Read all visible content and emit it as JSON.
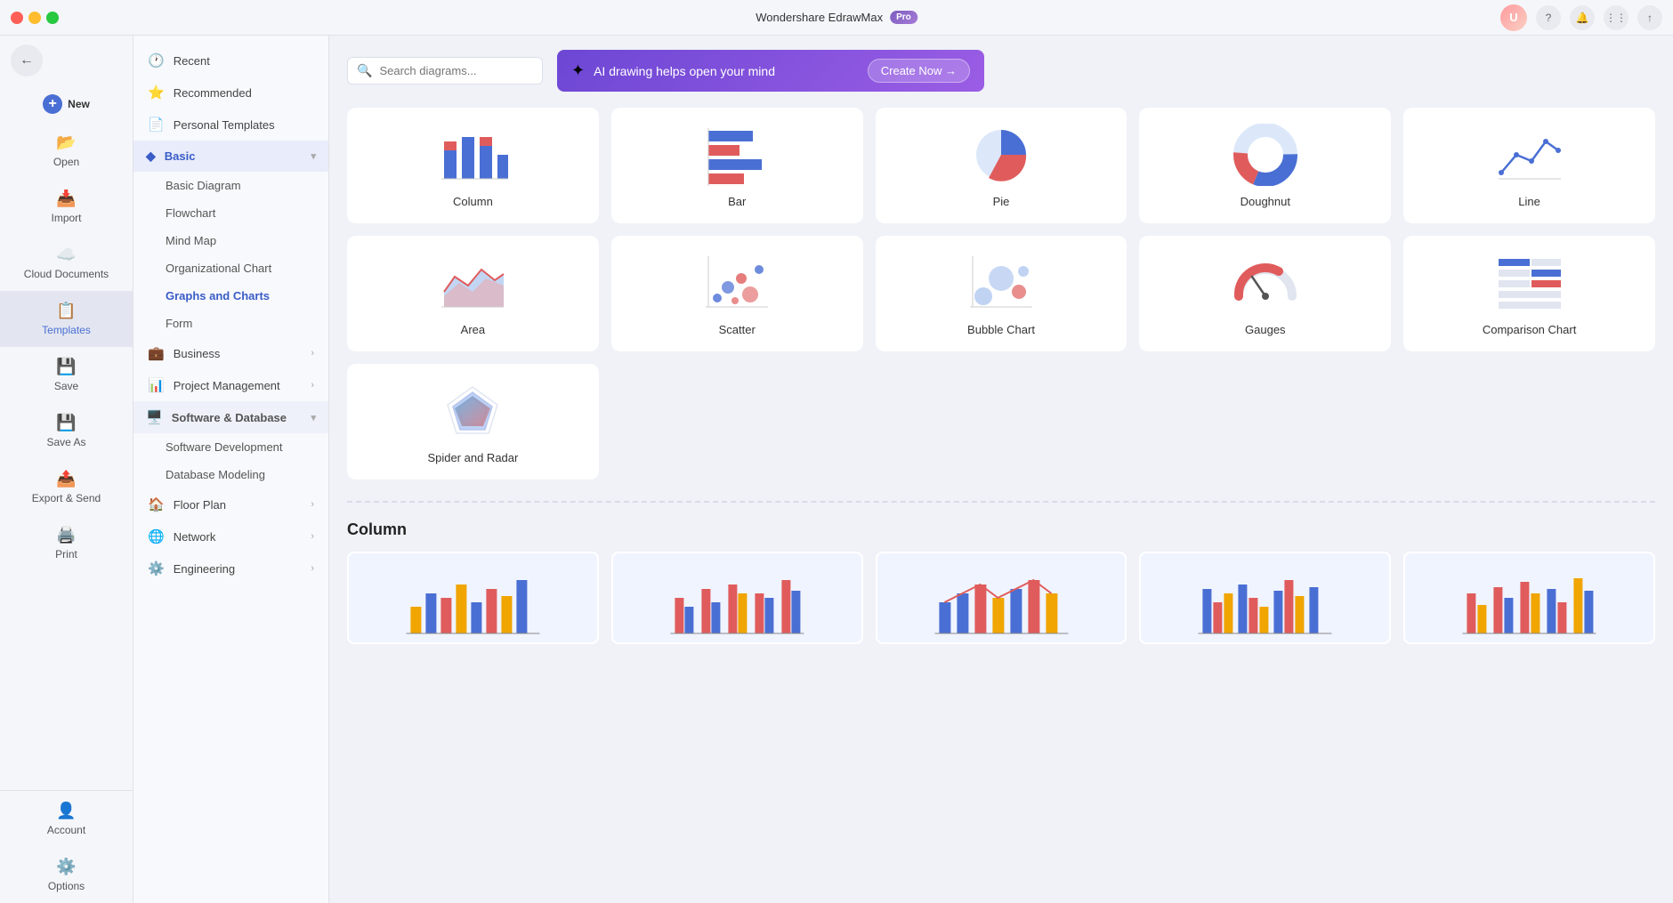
{
  "titleBar": {
    "title": "Wondershare EdrawMax",
    "proBadge": "Pro",
    "searchPlaceholder": "Search diagrams...",
    "aiBannerText": "AI drawing helps open your mind",
    "aiBannerBtn": "Create Now →"
  },
  "leftSidebar": {
    "items": [
      {
        "id": "new",
        "label": "New",
        "icon": "+"
      },
      {
        "id": "open",
        "label": "Open",
        "icon": "📂"
      },
      {
        "id": "import",
        "label": "Import",
        "icon": "📥"
      },
      {
        "id": "cloud",
        "label": "Cloud Documents",
        "icon": "☁️"
      },
      {
        "id": "templates",
        "label": "Templates",
        "icon": "📋"
      },
      {
        "id": "save",
        "label": "Save",
        "icon": "💾"
      },
      {
        "id": "saveas",
        "label": "Save As",
        "icon": "💾"
      },
      {
        "id": "export",
        "label": "Export & Send",
        "icon": "📤"
      },
      {
        "id": "print",
        "label": "Print",
        "icon": "🖨️"
      }
    ],
    "bottomItems": [
      {
        "id": "account",
        "label": "Account",
        "icon": "👤"
      },
      {
        "id": "options",
        "label": "Options",
        "icon": "⚙️"
      }
    ]
  },
  "middlePanel": {
    "topItems": [
      {
        "id": "recent",
        "label": "Recent",
        "icon": "🕐"
      },
      {
        "id": "recommended",
        "label": "Recommended",
        "icon": "⭐"
      },
      {
        "id": "personal",
        "label": "Personal Templates",
        "icon": "📄"
      }
    ],
    "categories": [
      {
        "id": "basic",
        "label": "Basic",
        "icon": "◆",
        "expanded": true,
        "children": [
          "Basic Diagram",
          "Flowchart",
          "Mind Map",
          "Organizational Chart",
          "Graphs and Charts",
          "Form"
        ]
      },
      {
        "id": "business",
        "label": "Business",
        "icon": "💼",
        "expanded": false,
        "children": []
      },
      {
        "id": "project",
        "label": "Project Management",
        "icon": "📊",
        "expanded": false,
        "children": []
      },
      {
        "id": "software",
        "label": "Software & Database",
        "icon": "🖥️",
        "expanded": true,
        "children": [
          "Software Development",
          "Database Modeling"
        ]
      },
      {
        "id": "floorplan",
        "label": "Floor Plan",
        "icon": "🏠",
        "expanded": false,
        "children": []
      },
      {
        "id": "network",
        "label": "Network",
        "icon": "🌐",
        "expanded": false,
        "children": []
      },
      {
        "id": "engineering",
        "label": "Engineering",
        "icon": "⚙️",
        "expanded": false,
        "children": []
      }
    ]
  },
  "chartTypes": [
    {
      "id": "column",
      "label": "Column"
    },
    {
      "id": "bar",
      "label": "Bar"
    },
    {
      "id": "pie",
      "label": "Pie"
    },
    {
      "id": "doughnut",
      "label": "Doughnut"
    },
    {
      "id": "line",
      "label": "Line"
    },
    {
      "id": "area",
      "label": "Area"
    },
    {
      "id": "scatter",
      "label": "Scatter"
    },
    {
      "id": "bubble",
      "label": "Bubble Chart"
    },
    {
      "id": "gauges",
      "label": "Gauges"
    },
    {
      "id": "comparison",
      "label": "Comparison Chart"
    },
    {
      "id": "spider",
      "label": "Spider and Radar"
    }
  ],
  "sectionTitle": "Column",
  "colors": {
    "accent": "#4a6fd4",
    "proBg": "#7c5cbf",
    "aiBg": "#6c47d4"
  }
}
